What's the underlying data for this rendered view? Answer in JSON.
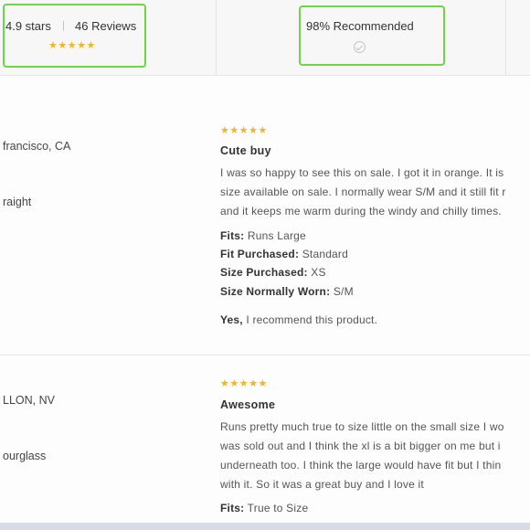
{
  "summary": {
    "rating_text": "4.9 stars",
    "separator": "|",
    "reviews_text": "46 Reviews",
    "rating_stars": "★★★★★",
    "recommended_text": "98% Recommended"
  },
  "reviews": [
    {
      "location": "francisco, CA",
      "body_shape": "raight",
      "stars": "★★★★★",
      "title": "Cute buy",
      "body_lines": [
        "I was so happy to see this on sale. I got it in orange. It is",
        "size available on sale. I normally wear S/M and it still fit r",
        "and it keeps me warm during the windy and chilly times."
      ],
      "fits_label": "Fits:",
      "fits_value": "Runs Large",
      "fit_purchased_label": "Fit Purchased:",
      "fit_purchased_value": "Standard",
      "size_purchased_label": "Size Purchased:",
      "size_purchased_value": "XS",
      "size_normally_label": "Size Normally Worn:",
      "size_normally_value": "S/M",
      "recommend_label": "Yes,",
      "recommend_text": "I recommend this product."
    },
    {
      "location": "LLON, NV",
      "body_shape": "ourglass",
      "stars": "★★★★★",
      "title": "Awesome",
      "body_lines": [
        "Runs pretty much true to size little on the small size I wo",
        "was sold out and I think the xl is a bit bigger on me but i",
        "underneath too. I think the large would have fit but I thin",
        "with it. So it was a great buy and I love it"
      ],
      "fits_label": "Fits:",
      "fits_value": "True to Size"
    }
  ]
}
